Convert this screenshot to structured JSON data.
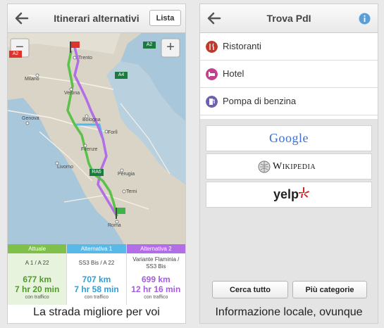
{
  "left_screen": {
    "title": "Itinerari alternativi",
    "list_button": "Lista",
    "map": {
      "zoom_out": "−",
      "zoom_in": "+",
      "highway_labels": [
        "A2",
        "A2",
        "A4",
        "RA6"
      ],
      "city_labels": [
        "Trento",
        "Milano",
        "Verona",
        "Genova",
        "Bologna",
        "Forlì",
        "Firenze",
        "Livorno",
        "Perugia",
        "Terni",
        "Roma"
      ]
    },
    "routes": [
      {
        "header": "Attuale",
        "name": "A 1 / A 22",
        "distance": "677 km",
        "time": "7 hr 20 min",
        "traffic": "con traffico",
        "color": "#7ec04a",
        "text_color": "#4e9a28",
        "bg": "#e8f3de"
      },
      {
        "header": "Alternativa 1",
        "name": "SS3 Bis / A 22",
        "distance": "707 km",
        "time": "7 hr 58 min",
        "traffic": "con traffico",
        "color": "#5ab8e6",
        "text_color": "#2f9ed6",
        "bg": "#ffffff"
      },
      {
        "header": "Alternativa 2",
        "name": "Variante Flaminia / SS3 Bis",
        "distance": "699 km",
        "time": "12 hr 16 min",
        "traffic": "con traffico",
        "color": "#b26ee6",
        "text_color": "#a45ce0",
        "bg": "#ffffff"
      }
    ],
    "caption": "La strada migliore per voi"
  },
  "right_screen": {
    "title": "Trova PdI",
    "categories": [
      {
        "label": "Ristoranti",
        "icon": "restaurant-icon",
        "color": "#c0392b"
      },
      {
        "label": "Hotel",
        "icon": "hotel-icon",
        "color": "#c2408e"
      },
      {
        "label": "Pompa di benzina",
        "icon": "gas-pump-icon",
        "color": "#6f5fb0"
      }
    ],
    "providers": {
      "google": "Google",
      "wikipedia": "Wikipedia",
      "yelp": "yelp"
    },
    "buttons": {
      "search_all": "Cerca tutto",
      "more_categories": "Più categorie"
    },
    "caption": "Informazione locale, ovunque"
  }
}
